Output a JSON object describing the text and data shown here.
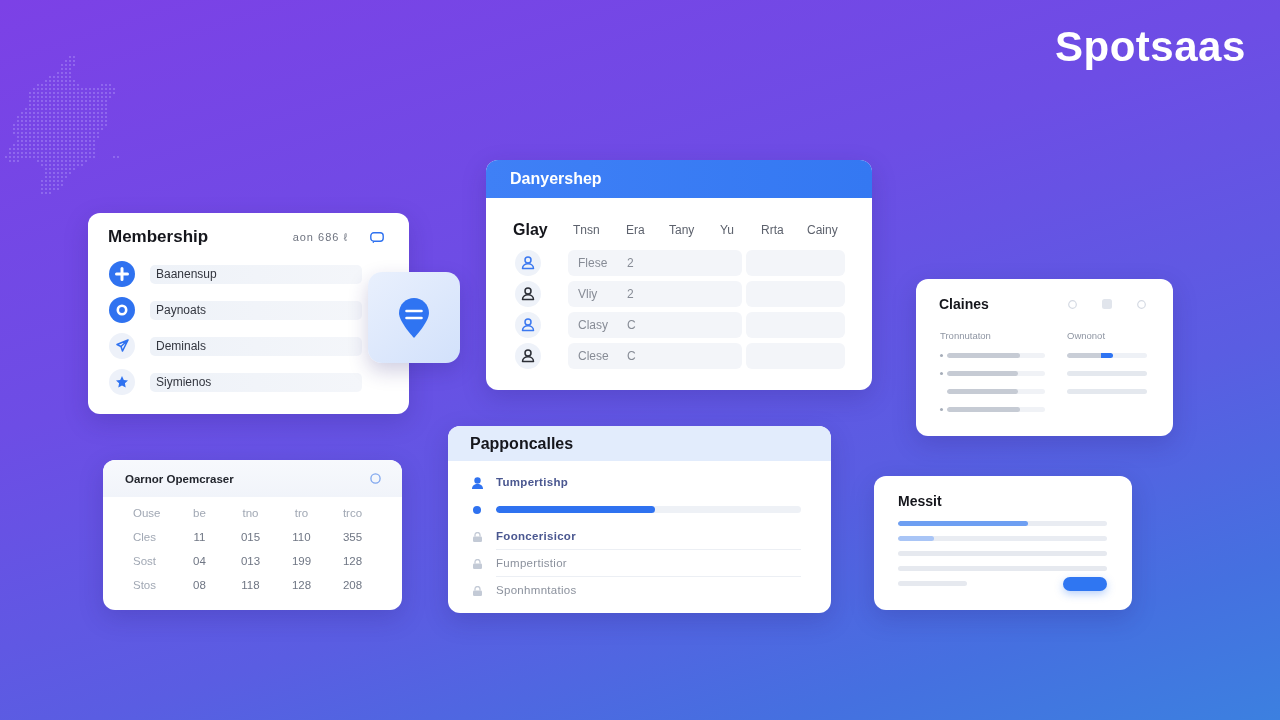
{
  "logo": {
    "text": "Spotsaas"
  },
  "membership": {
    "title": "Membership",
    "meta": "aon 686 ℓ",
    "items": [
      {
        "label": "Baanensup",
        "active": true
      },
      {
        "label": "Paynoats",
        "active": true
      },
      {
        "label": "Deminals",
        "active": false
      },
      {
        "label": "Siymienos",
        "active": false
      }
    ]
  },
  "roster": {
    "title": "Danyershep",
    "corner_label": "Glay",
    "columns": [
      "Tnsn",
      "Era",
      "Tany",
      "Yu",
      "Rrta",
      "Cainy"
    ],
    "rows": [
      {
        "name": "Flese",
        "value": "2",
        "highlighted": true
      },
      {
        "name": "Vliy",
        "value": "2",
        "highlighted": false
      },
      {
        "name": "Clasy",
        "value": "C",
        "highlighted": true
      },
      {
        "name": "Clese",
        "value": "C",
        "highlighted": false
      }
    ]
  },
  "claines": {
    "title": "Claines",
    "column_labels": [
      "Tronnutaton",
      "Ownonot"
    ],
    "left_bars": [
      {
        "level": 0.74,
        "bullet": true
      },
      {
        "level": 0.72,
        "bullet": true
      },
      {
        "level": 0.72,
        "bullet": false
      },
      {
        "level": 0.74,
        "bullet": true
      }
    ],
    "right_bars": [
      {
        "level": 0.58
      }
    ]
  },
  "messit": {
    "title": "Messit",
    "bars": [
      {
        "level": 0.62
      },
      {
        "level": 0.17
      }
    ]
  },
  "oarnor": {
    "title": "Oarnor Opemcraser",
    "columns": [
      "Ouse",
      "be",
      "tno",
      "tro",
      "trco"
    ],
    "rows": [
      [
        "Cles",
        "11",
        "015",
        "110",
        "355"
      ],
      [
        "Sost",
        "04",
        "013",
        "199",
        "128"
      ],
      [
        "Stos",
        "08",
        "118",
        "128",
        "208"
      ]
    ]
  },
  "papponcalles": {
    "title": "Papponcalles",
    "items": [
      {
        "kind": "text",
        "label": "Tumpertishp",
        "active": true
      },
      {
        "kind": "progress",
        "level": 0.52
      },
      {
        "kind": "text",
        "label": "Fooncerisicor",
        "active": true
      },
      {
        "kind": "text",
        "label": "Fumpertistior",
        "active": false
      },
      {
        "kind": "text",
        "label": "Sponhmntatios",
        "active": false
      }
    ]
  }
}
